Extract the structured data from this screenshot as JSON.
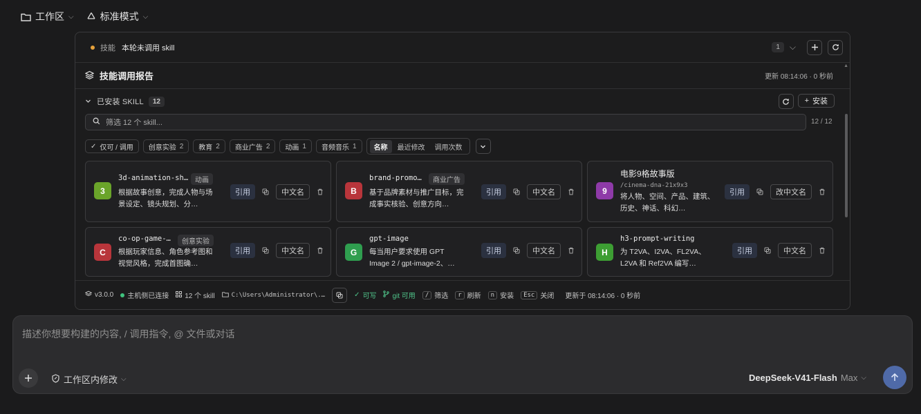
{
  "topbar": {
    "workspace_label": "工作区",
    "mode_label": "标准模式"
  },
  "skill_bar": {
    "label": "技能",
    "status": "本轮未调用 skill",
    "count": "1"
  },
  "report": {
    "title": "技能调用报告",
    "updated": "更新 08:14:06 · 0 秒前"
  },
  "installed": {
    "title": "已安装 SKILL",
    "count": "12",
    "install_label": "安装",
    "search_placeholder": "筛选 12 个 skill...",
    "search_count": "12 / 12",
    "filters": [
      {
        "label": "仅可 / 调用",
        "count": ""
      },
      {
        "label": "创意实验",
        "count": "2"
      },
      {
        "label": "教育",
        "count": "2"
      },
      {
        "label": "商业广告",
        "count": "2"
      },
      {
        "label": "动画",
        "count": "1"
      },
      {
        "label": "音频音乐",
        "count": "1"
      }
    ],
    "sorts": [
      "名称",
      "最近修改",
      "调用次数"
    ]
  },
  "cards": [
    {
      "badge": "3",
      "color": "#6aa42a",
      "name": "3d-animation-sh…",
      "tag": "动画",
      "desc": "根据故事创意，完成人物与场景设定、镜头规划、分…",
      "cite": "引用",
      "cn": "中文名"
    },
    {
      "badge": "B",
      "color": "#b8353b",
      "name": "brand-promo…",
      "tag": "商业广告",
      "desc": "基于品牌素材与推广目标，完成事实核验、创意方向…",
      "cite": "引用",
      "cn": "中文名"
    },
    {
      "badge": "9",
      "color": "#8e3aa8",
      "name": "电影9格故事版",
      "path": "/cinema-dna-21x9x3",
      "desc": "将人物、空间、产品、建筑、历史、神话、科幻…",
      "cite": "引用",
      "cn": "改中文名"
    },
    {
      "badge": "C",
      "color": "#b8353b",
      "name": "co-op-game-…",
      "tag": "创意实验",
      "desc": "根据玩家信息、角色参考图和视觉风格，完成首图确…",
      "cite": "引用",
      "cn": "中文名"
    },
    {
      "badge": "G",
      "color": "#2f9e4f",
      "name": "gpt-image",
      "desc": "每当用户要求使用 GPT Image 2 / gpt-image-2、…",
      "cite": "引用",
      "cn": "中文名"
    },
    {
      "badge": "H",
      "color": "#3d9e33",
      "name": "h3-prompt-writing",
      "desc": "为 T2VA、I2VA、FL2VA、L2VA 和 Ref2VA 编写…",
      "cite": "引用",
      "cn": "中文名"
    }
  ],
  "statusbar": {
    "version": "v3.0.0",
    "host": "主机侧已连接",
    "skills": "12 个 skill",
    "path": "C:\\Users\\Administrator\\.…",
    "writable": "可写",
    "git": "git 可用",
    "k_filter": "/",
    "k_filter_label": "筛选",
    "k_refresh": "r",
    "k_refresh_label": "刷新",
    "k_install": "n",
    "k_install_label": "安装",
    "k_close": "Esc",
    "k_close_label": "关闭",
    "updated": "更新于 08:14:06 · 0 秒前"
  },
  "composer": {
    "placeholder": "描述你想要构建的内容, / 调用指令, @ 文件或对话",
    "workspace_edit": "工作区内修改",
    "model": "DeepSeek-V41-Flash",
    "level": "Max"
  }
}
